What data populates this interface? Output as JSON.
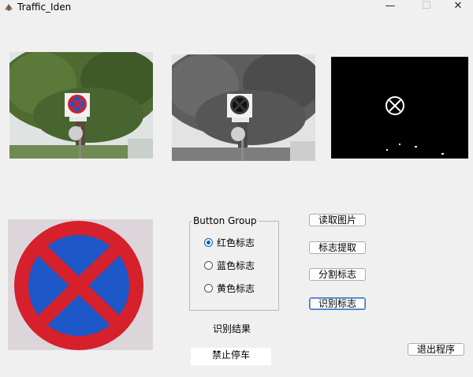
{
  "window": {
    "title": "Traffic_Iden",
    "minimize_glyph": "—",
    "maximize_glyph": "☐",
    "close_glyph": "✕"
  },
  "group": {
    "title": "Button Group",
    "options": [
      {
        "label": "红色标志",
        "selected": true
      },
      {
        "label": "蓝色标志",
        "selected": false
      },
      {
        "label": "黄色标志",
        "selected": false
      }
    ]
  },
  "buttons": {
    "read_image": "读取图片",
    "extract_sign": "标志提取",
    "segment_sign": "分割标志",
    "recognize_sign": "识别标志",
    "exit": "退出程序"
  },
  "result": {
    "label": "识别结果",
    "value": "禁止停车"
  },
  "colors": {
    "sign_red": "#d6202b",
    "sign_blue": "#1d57c8",
    "accent": "#0060b8"
  }
}
